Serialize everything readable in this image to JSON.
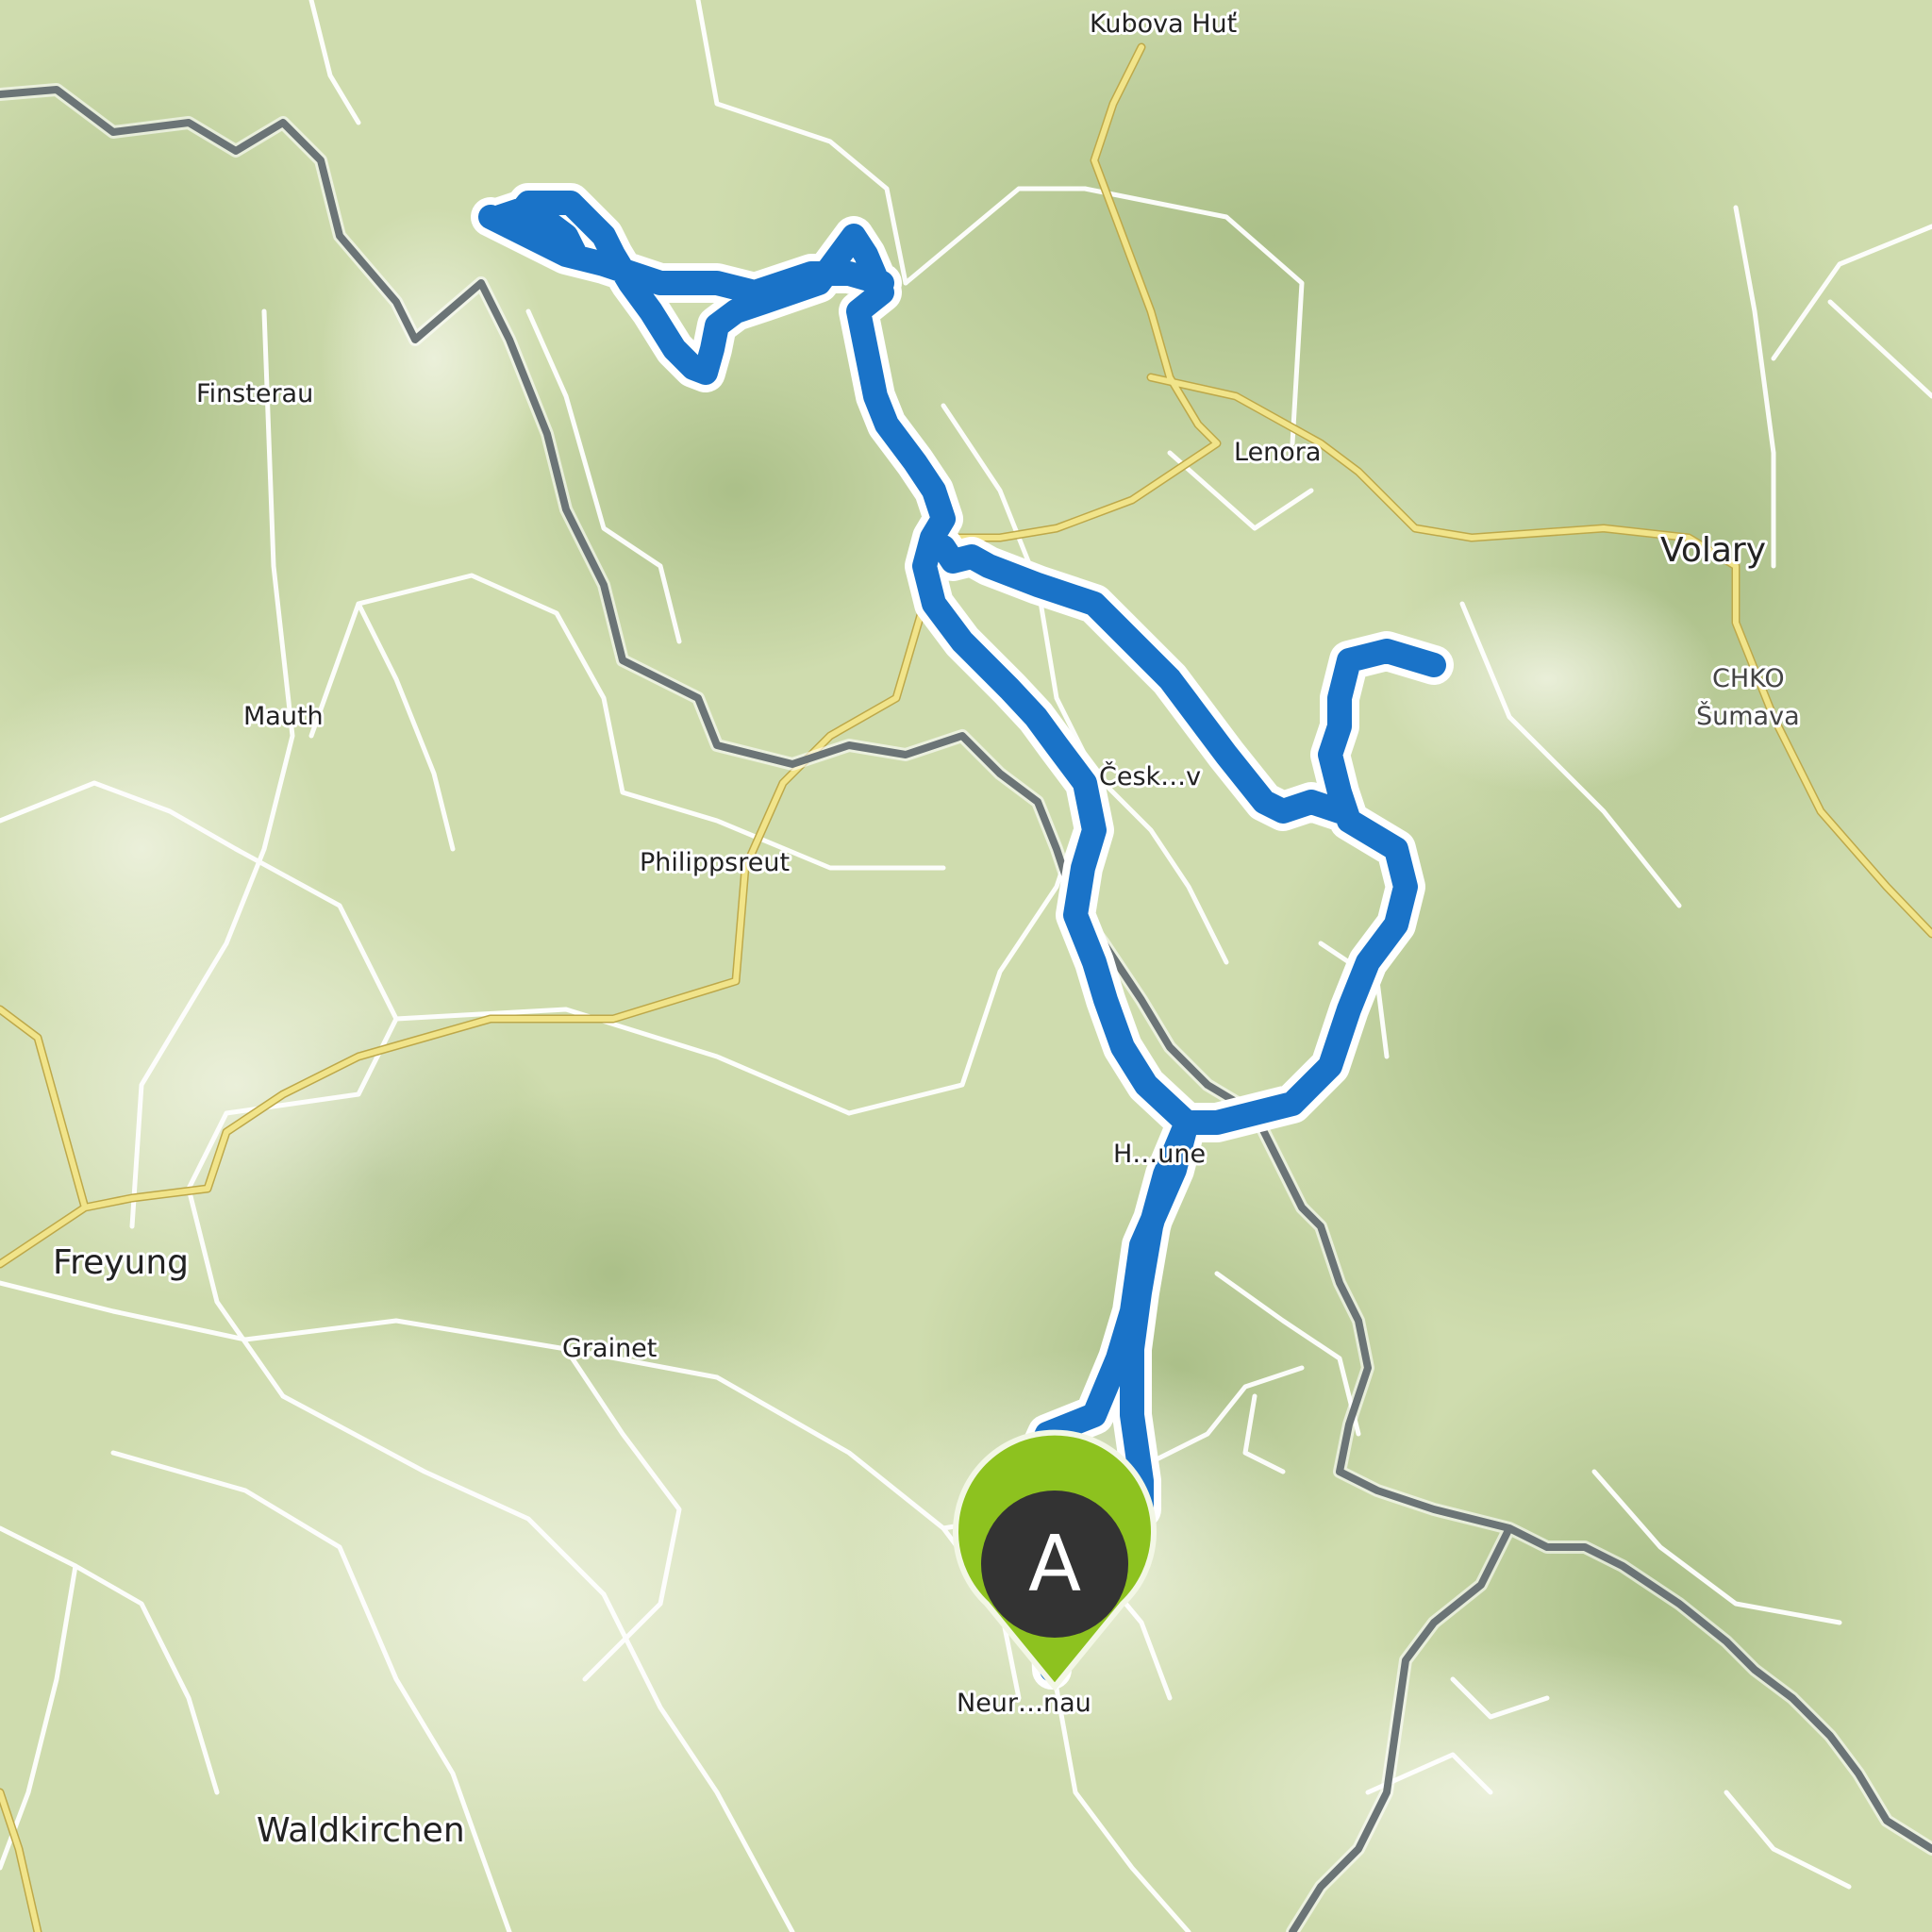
{
  "map": {
    "places": [
      {
        "key": "kubova",
        "name": "Kubova Huť"
      },
      {
        "key": "finsterau",
        "name": "Finsterau"
      },
      {
        "key": "lenora",
        "name": "Lenora"
      },
      {
        "key": "volary",
        "name": "Volary"
      },
      {
        "key": "chko1",
        "name": "CHKO"
      },
      {
        "key": "chko2",
        "name": "Šumava"
      },
      {
        "key": "mauth",
        "name": "Mauth"
      },
      {
        "key": "ceske",
        "name": "Česk…v"
      },
      {
        "key": "philippsreut",
        "name": "Philippsreut"
      },
      {
        "key": "horni",
        "name": "H…une"
      },
      {
        "key": "freyung",
        "name": "Freyung"
      },
      {
        "key": "grainet",
        "name": "Grainet"
      },
      {
        "key": "neureichenau",
        "name": "Neur…nau"
      },
      {
        "key": "waldkirchen",
        "name": "Waldkirchen"
      }
    ],
    "marker": {
      "label": "A",
      "fill": "#8dc21f",
      "inner": "#333333"
    },
    "colors": {
      "terrain": "#cfdcae",
      "forest": "#b6c98d",
      "meadow": "#e6ecd2",
      "route": "#1a73c8",
      "route_halo": "#ffffff",
      "border": "#6b7476",
      "main_road": "#e8d577",
      "minor_road": "#ffffff"
    }
  }
}
